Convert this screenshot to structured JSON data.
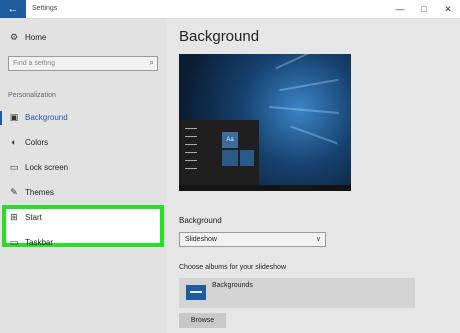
{
  "window": {
    "title": "Settings",
    "back_icon": "←",
    "minimize_icon": "—",
    "maximize_icon": "□",
    "close_icon": "✕"
  },
  "sidebar": {
    "home": {
      "label": "Home",
      "icon": "gear-icon",
      "glyph": "⚙"
    },
    "search": {
      "placeholder": "Find a setting",
      "icon": "search-icon",
      "glyph": "⌕"
    },
    "section_label": "Personalization",
    "items": [
      {
        "label": "Background",
        "icon": "picture-icon",
        "glyph": "▣",
        "active": true
      },
      {
        "label": "Colors",
        "icon": "palette-icon",
        "glyph": "◐"
      },
      {
        "label": "Lock screen",
        "icon": "lock-screen-icon",
        "glyph": "▭"
      },
      {
        "label": "Themes",
        "icon": "brush-icon",
        "glyph": "✎"
      },
      {
        "label": "Start",
        "icon": "start-icon",
        "glyph": "⊞",
        "highlighted": true
      },
      {
        "label": "Taskbar",
        "icon": "taskbar-icon",
        "glyph": "▭"
      }
    ]
  },
  "main": {
    "title": "Background",
    "preview_tile_label": "Aa",
    "background_label": "Background",
    "background_value": "Slideshow",
    "dropdown_glyph": "∨",
    "albums_label": "Choose albums for your slideshow",
    "album_name": "Backgrounds",
    "browse_label": "Browse"
  },
  "colors": {
    "accent": "#1a5aa6",
    "highlight": "#26e026"
  }
}
